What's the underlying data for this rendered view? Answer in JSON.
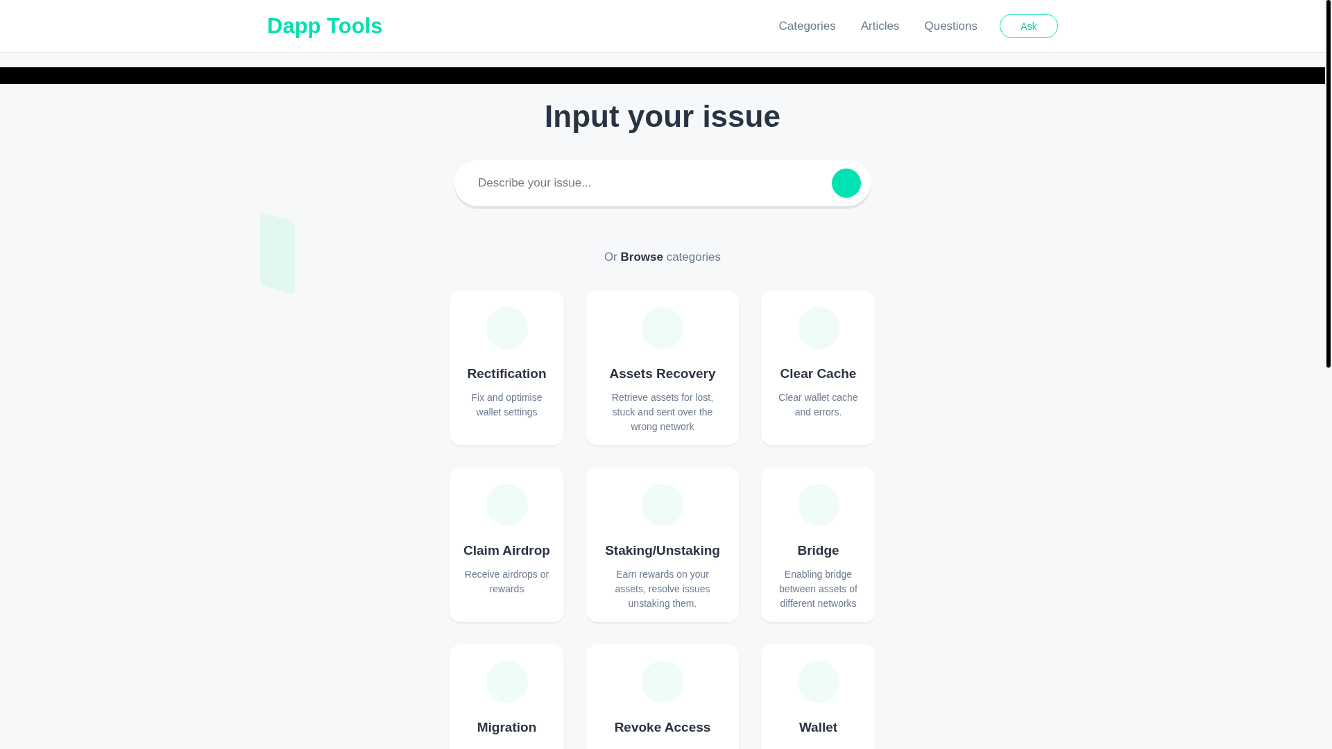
{
  "header": {
    "logo": "Dapp Tools",
    "nav": [
      {
        "label": "Categories"
      },
      {
        "label": "Articles"
      },
      {
        "label": "Questions"
      }
    ],
    "ask_button": "Ask"
  },
  "headline": "Input your issue",
  "search": {
    "placeholder": "Describe your issue..."
  },
  "browse_text": "Or **Browse** categories",
  "categories": [
    {
      "title": "Rectification",
      "description": "Fix and optimise wallet settings"
    },
    {
      "title": "Assets Recovery",
      "description": "Retrieve assets for lost, stuck and sent over the wrong network"
    },
    {
      "title": "Clear Cache",
      "description": "Clear wallet cache and errors."
    },
    {
      "title": "Claim Airdrop",
      "description": "Receive airdrops or rewards"
    },
    {
      "title": "Staking/Unstaking",
      "description": "Earn rewards on your assets, resolve issues unstaking them."
    },
    {
      "title": "Bridge",
      "description": "Enabling bridge between assets of different networks"
    },
    {
      "title": "Migration"
    },
    {
      "title": "Revoke Access"
    },
    {
      "title": "Wallet"
    }
  ]
}
